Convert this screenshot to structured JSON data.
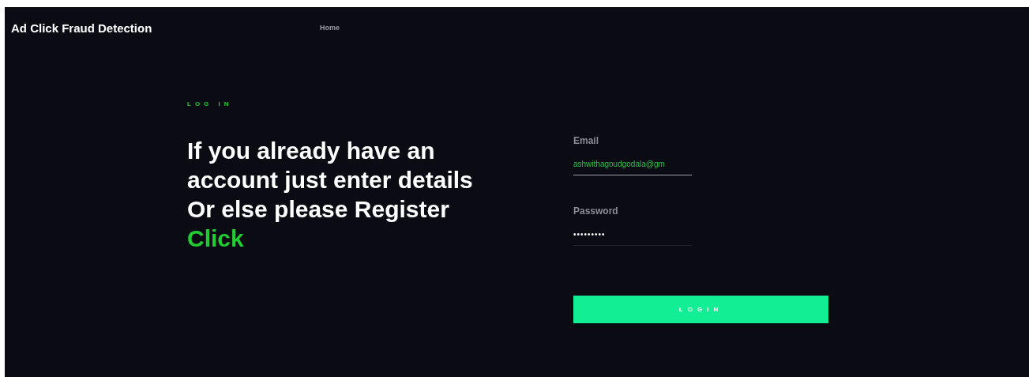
{
  "header": {
    "title": "Ad Click Fraud Detection",
    "nav": [
      {
        "label": "Home"
      }
    ]
  },
  "intro": {
    "eyebrow": "LOG IN",
    "heading": "If you already have an account just enter details Or else please Register",
    "link": "Click"
  },
  "form": {
    "fields": [
      {
        "label": "Email",
        "value": "ashwithagoudgodala@gm",
        "kind": "text"
      },
      {
        "label": "Password",
        "value": "•••••••••",
        "kind": "password"
      }
    ],
    "button": "LOGIN"
  }
}
